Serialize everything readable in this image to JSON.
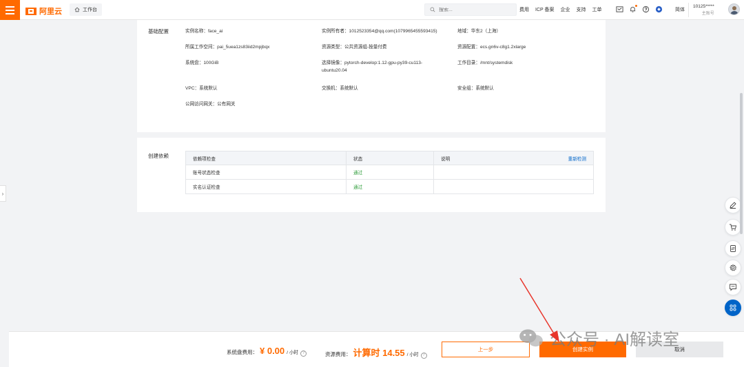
{
  "header": {
    "brand": "阿里云",
    "workbench": "工作台",
    "search_placeholder": "搜索...",
    "nav": [
      "费用",
      "ICP 备案",
      "企业",
      "支持",
      "工单"
    ],
    "lang": "简体",
    "user_id": "10125*****",
    "user_role": "主账号"
  },
  "basic_config": {
    "title": "基础配置",
    "rows": [
      [
        "实例名称：face_ai",
        "实例所有者：1012523354@qq.com(1079965455593415)",
        "地域：华东2（上海）"
      ],
      [
        "所属工作空间：pai_5uea1zs83iid2mpjbqx",
        "资源类型：公共资源组-按量付费",
        "资源配置：ecs.gn6v-c8g1.2xlarge"
      ],
      [
        "系统盘：100GiB",
        "选择镜像：pytorch-develop:1.12-gpu-py39-cu113-ubuntu20.04",
        "工作目录：/mnt/systemdisk"
      ],
      [
        "VPC：系统默认",
        "交换机：系统默认",
        "安全组：系统默认"
      ],
      [
        "公网访问网关：公有网关",
        "",
        ""
      ]
    ]
  },
  "dependencies": {
    "title": "创建依赖",
    "columns": [
      "依赖项检查",
      "状态",
      "说明"
    ],
    "recheck": "重新检测",
    "rows": [
      {
        "item": "账号状态检查",
        "status": "通过",
        "note": ""
      },
      {
        "item": "实名认证检查",
        "status": "通过",
        "note": ""
      }
    ]
  },
  "footer": {
    "disk_fee_label": "系统盘费用：",
    "disk_fee_amount": "¥ 0.00",
    "disk_fee_unit": "/ 小时",
    "resource_fee_label": "资源费用：",
    "resource_fee_amount": "计算时 14.55",
    "resource_fee_unit": "/ 小时",
    "prev_button": "上一步",
    "create_button": "创建实例",
    "cancel_button": "取消"
  },
  "watermark": "公众号 · AI解读室",
  "colors": {
    "accent": "#ff6a00",
    "link": "#0064c8",
    "success": "#2e9c3a",
    "annotation_arrow": "#e8352b"
  }
}
